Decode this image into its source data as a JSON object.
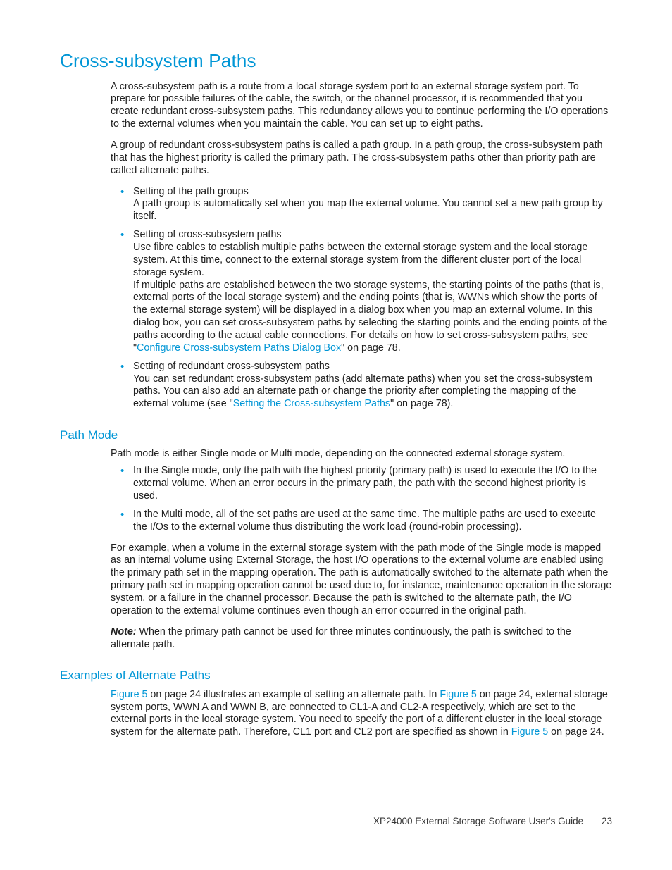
{
  "h1": "Cross-subsystem Paths",
  "intro_p1": "A cross-subsystem path is a route from a local storage system port to an external storage system port. To prepare for possible failures of the cable, the switch, or the channel processor, it is recommended that you create redundant cross-subsystem paths. This redundancy allows you to continue performing the I/O operations to the external volumes when you maintain the cable. You can set up to eight paths.",
  "intro_p2": "A group of redundant cross-subsystem paths is called a path group. In a path group, the cross-subsystem path that has the highest priority is called the primary path. The cross-subsystem paths other than priority path are called alternate paths.",
  "b1_title": "Setting of the path groups",
  "b1_text": "A path group is automatically set when you map the external volume. You cannot set a new path group by itself.",
  "b2_title": "Setting of cross-subsystem paths",
  "b2_text_a": "Use fibre cables to establish multiple paths between the external storage system and the local storage system. At this time, connect to the external storage system from the different cluster port of the local storage system.",
  "b2_text_b_pre": "If multiple paths are established between the two storage systems, the starting points of the paths (that is, external ports of the local storage system) and the ending points (that is, WWNs which show the ports of the external storage system) will be displayed in a dialog box when you map an external volume. In this dialog box, you can set cross-subsystem paths by selecting the starting points and the ending points of the paths according to the actual cable connections. For details on how to set cross-subsystem paths, see \"",
  "b2_link": "Configure Cross-subsystem Paths Dialog Box",
  "b2_text_b_post": "\" on page 78.",
  "b3_title": "Setting of redundant cross-subsystem paths",
  "b3_text_pre": "You can set redundant cross-subsystem paths (add alternate paths) when you set the cross-subsystem paths. You can also add an alternate path or change the priority after completing the mapping of the external volume (see \"",
  "b3_link": "Setting the Cross-subsystem Paths",
  "b3_text_post": "\" on page 78).",
  "h2_pathmode": "Path Mode",
  "pm_p1": "Path mode is either Single mode or Multi mode, depending on the connected external storage system.",
  "pm_b1": "In the Single mode, only the path with the highest priority (primary path) is used to execute the I/O to the external volume. When an error occurs in the primary path, the path with the second highest priority is used.",
  "pm_b2": "In the Multi mode, all of the set paths are used at the same time. The multiple paths are used to execute the I/Os to the external volume thus distributing the work load (round-robin processing).",
  "pm_p2": "For example, when a volume in the external storage system with the path mode of the Single mode is mapped as an internal volume using External Storage, the host I/O operations to the external volume are enabled using the primary path set in the mapping operation. The path is automatically switched to the alternate path when the primary path set in mapping operation cannot be used due to, for instance, maintenance operation in the storage system, or a failure in the channel processor. Because the path is switched to the alternate path, the I/O operation to the external volume continues even though an error occurred in the original path.",
  "note_label": "Note:",
  "note_text": " When the primary path cannot be used for three minutes continuously, the path is switched to the alternate path.",
  "h2_examples": "Examples of Alternate Paths",
  "ex_link1": "Figure 5",
  "ex_seg1": " on page 24 illustrates an example of setting an alternate path. In ",
  "ex_link2": "Figure 5",
  "ex_seg2": " on page 24, external storage system ports, WWN A and WWN B, are connected to CL1-A and CL2-A respectively, which are set to the external ports in the local storage system. You need to specify the port of a different cluster in the local storage system for the alternate path. Therefore, CL1 port and CL2 port are specified as shown in ",
  "ex_link3": "Figure 5",
  "ex_seg3": " on page 24.",
  "footer_title": "XP24000 External Storage Software User's Guide",
  "footer_page": "23"
}
